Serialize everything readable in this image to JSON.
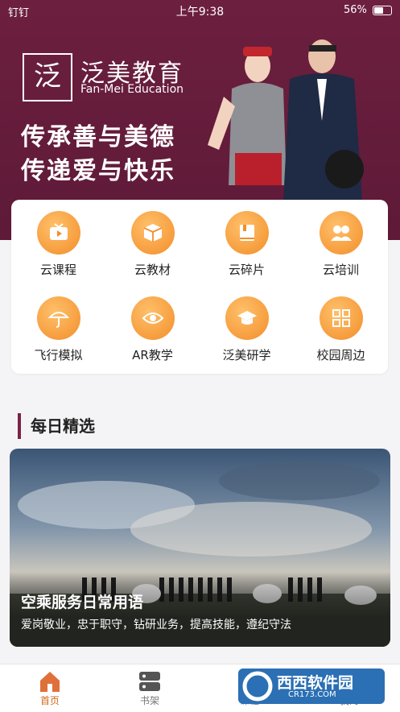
{
  "status": {
    "carrier": "钉钉",
    "time": "上午9:38",
    "battery": "56%",
    "battery_level": 0.56
  },
  "banner": {
    "brand_logo_char": "泛",
    "brand_cn": "泛美教育",
    "brand_en": "Fan-Mei Education",
    "slogan_1": "传承善与美德",
    "slogan_2": "传递爱与快乐"
  },
  "menu": [
    {
      "label": "云课程",
      "icon": "tv-icon"
    },
    {
      "label": "云教材",
      "icon": "box-icon"
    },
    {
      "label": "云碎片",
      "icon": "book-icon"
    },
    {
      "label": "云培训",
      "icon": "group-icon"
    },
    {
      "label": "飞行模拟",
      "icon": "umbrella-icon"
    },
    {
      "label": "AR教学",
      "icon": "eye-icon"
    },
    {
      "label": "泛美研学",
      "icon": "graduation-cap-icon"
    },
    {
      "label": "校园周边",
      "icon": "grid-icon"
    }
  ],
  "section": {
    "title": "每日精选"
  },
  "feature": {
    "title": "空乘服务日常用语",
    "subtitle": "爱岗敬业，忠于职守，钻研业务，提高技能，遵纪守法"
  },
  "tabs": [
    {
      "label": "首页",
      "icon": "home-icon",
      "active": true
    },
    {
      "label": "书架",
      "icon": "bookshelf-icon",
      "active": false
    },
    {
      "label": "课程",
      "icon": "course-icon",
      "active": false
    },
    {
      "label": "我的",
      "icon": "profile-icon",
      "active": false
    }
  ],
  "watermark": {
    "text": "西西软件园",
    "url": "CR173.COM"
  },
  "colors": {
    "brand": "#6d1f3f",
    "accent": "#f28e2a",
    "tab_active": "#d2691e"
  }
}
